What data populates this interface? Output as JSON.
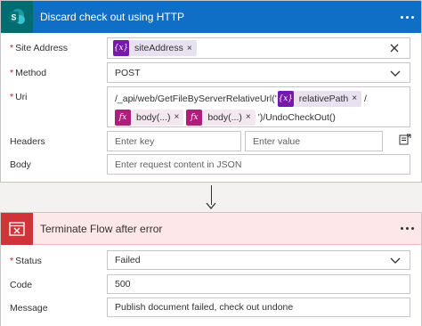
{
  "http_action": {
    "title": "Discard check out using HTTP",
    "icon": "sharepoint-icon",
    "accent_color": "#0f6fc6",
    "more_label": "...",
    "site_address": {
      "label": "Site Address",
      "required": "*",
      "token": {
        "type": "variable",
        "icon": "{x}",
        "label": "siteAddress",
        "close": "×"
      }
    },
    "method": {
      "label": "Method",
      "required": "*",
      "value": "POST"
    },
    "uri": {
      "label": "Uri",
      "required": "*",
      "prefix": "/_api/web/GetFileByServerRelativeUrl('",
      "token1": {
        "icon": "{x}",
        "label": "relativePath",
        "close": "×"
      },
      "middle": "/",
      "token2": {
        "icon": "fx",
        "label": "body(...)",
        "close": "×"
      },
      "token3": {
        "icon": "fx",
        "label": "body(...)",
        "close": "×"
      },
      "suffix": "')/UndoCheckOut()"
    },
    "headers": {
      "label": "Headers",
      "key_placeholder": "Enter key",
      "value_placeholder": "Enter value"
    },
    "body": {
      "label": "Body",
      "placeholder": "Enter request content in JSON"
    }
  },
  "terminate_action": {
    "title": "Terminate Flow after error",
    "icon": "terminate-icon",
    "accent_color": "#d13438",
    "more_label": "...",
    "status": {
      "label": "Status",
      "required": "*",
      "value": "Failed"
    },
    "code": {
      "label": "Code",
      "value": "500"
    },
    "message": {
      "label": "Message",
      "value": "Publish document failed, check out undone"
    }
  }
}
